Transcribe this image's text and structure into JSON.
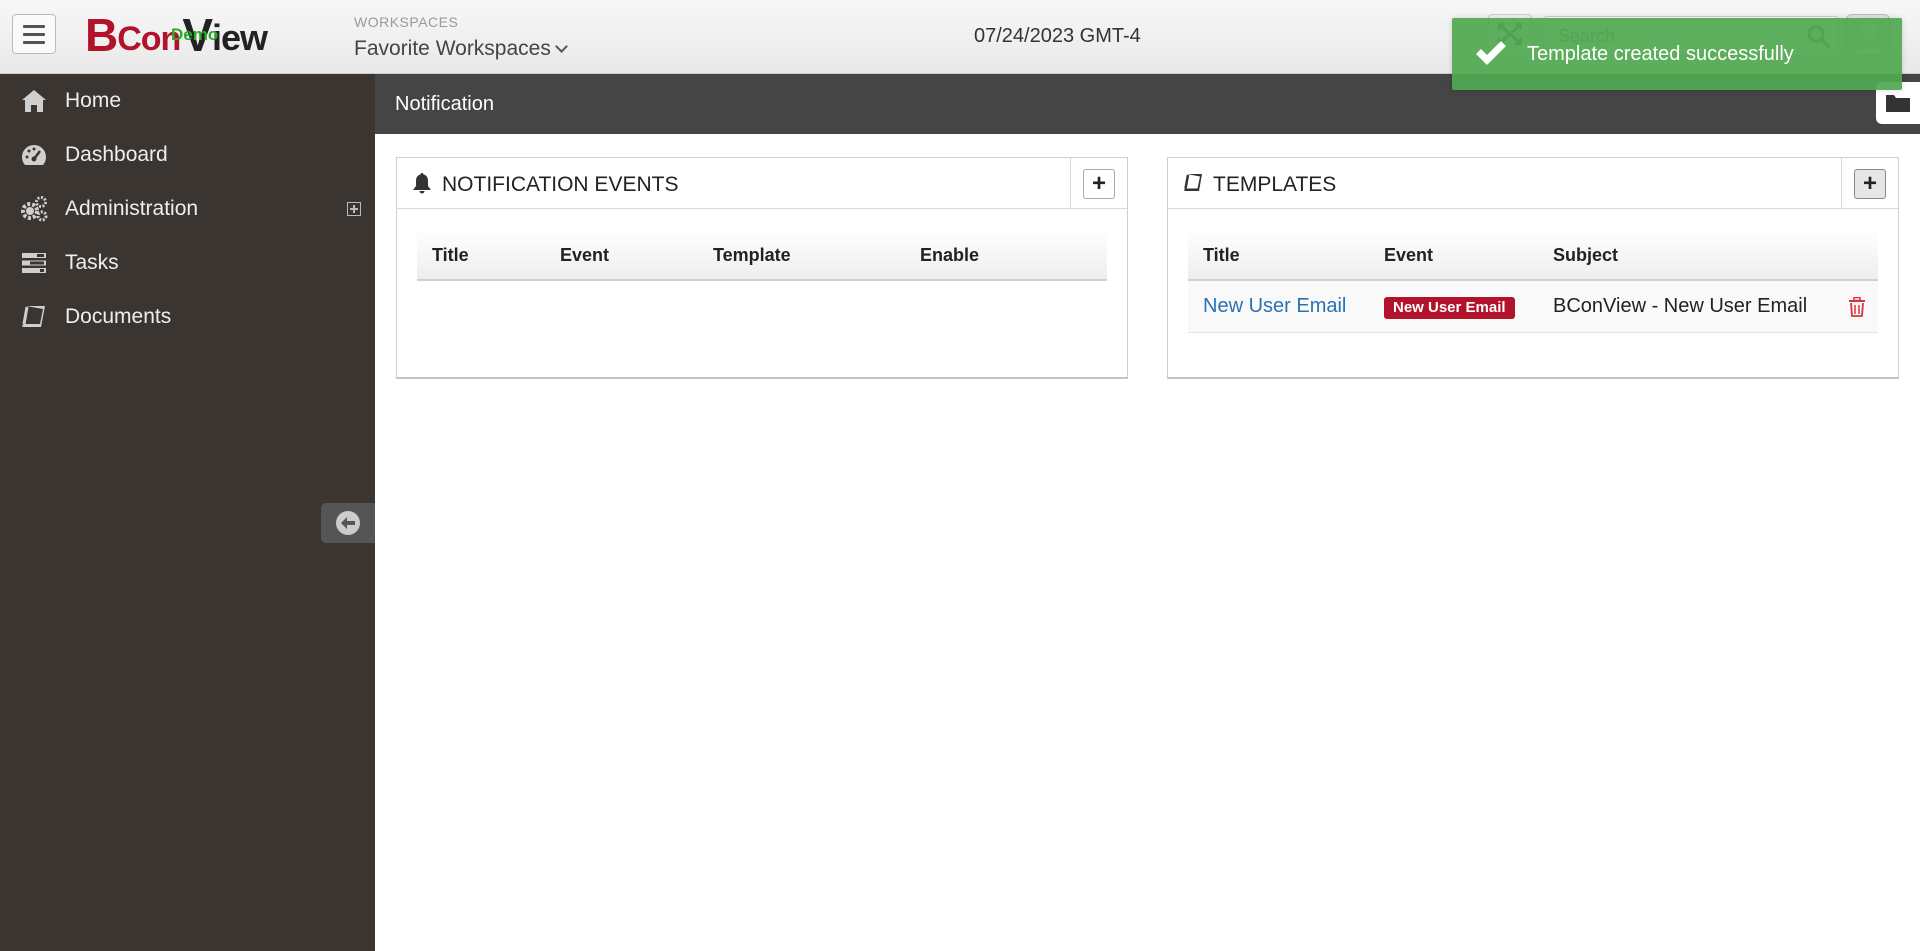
{
  "header": {
    "brand_prefix": "B",
    "brand_con": "Con",
    "brand_v": "V",
    "brand_iew": "iew",
    "demo_label": "Demo",
    "workspaces_caption": "WORKSPACES",
    "workspaces_selected": "Favorite Workspaces",
    "date": "07/24/2023 GMT-4",
    "search_placeholder": "Search"
  },
  "sidebar": {
    "items": [
      {
        "label": "Home",
        "icon": "home-icon"
      },
      {
        "label": "Dashboard",
        "icon": "dashboard-icon"
      },
      {
        "label": "Administration",
        "icon": "gears-icon"
      },
      {
        "label": "Tasks",
        "icon": "tasks-icon"
      },
      {
        "label": "Documents",
        "icon": "book-icon"
      }
    ]
  },
  "page": {
    "title": "Notification"
  },
  "events_panel": {
    "title": "NOTIFICATION EVENTS",
    "columns": [
      "Title",
      "Event",
      "Template",
      "Enable"
    ]
  },
  "templates_panel": {
    "title": "TEMPLATES",
    "columns": [
      "Title",
      "Event",
      "Subject"
    ],
    "rows": [
      {
        "title": "New User Email",
        "event": "New User Email",
        "subject": "BConView - New User Email"
      }
    ]
  },
  "toast": {
    "message": "Template created successfully"
  },
  "colors": {
    "brand_red": "#b3132a",
    "sidebar_bg": "#3b3532",
    "toast_green": "#51a851",
    "link_blue": "#2a72b5"
  }
}
